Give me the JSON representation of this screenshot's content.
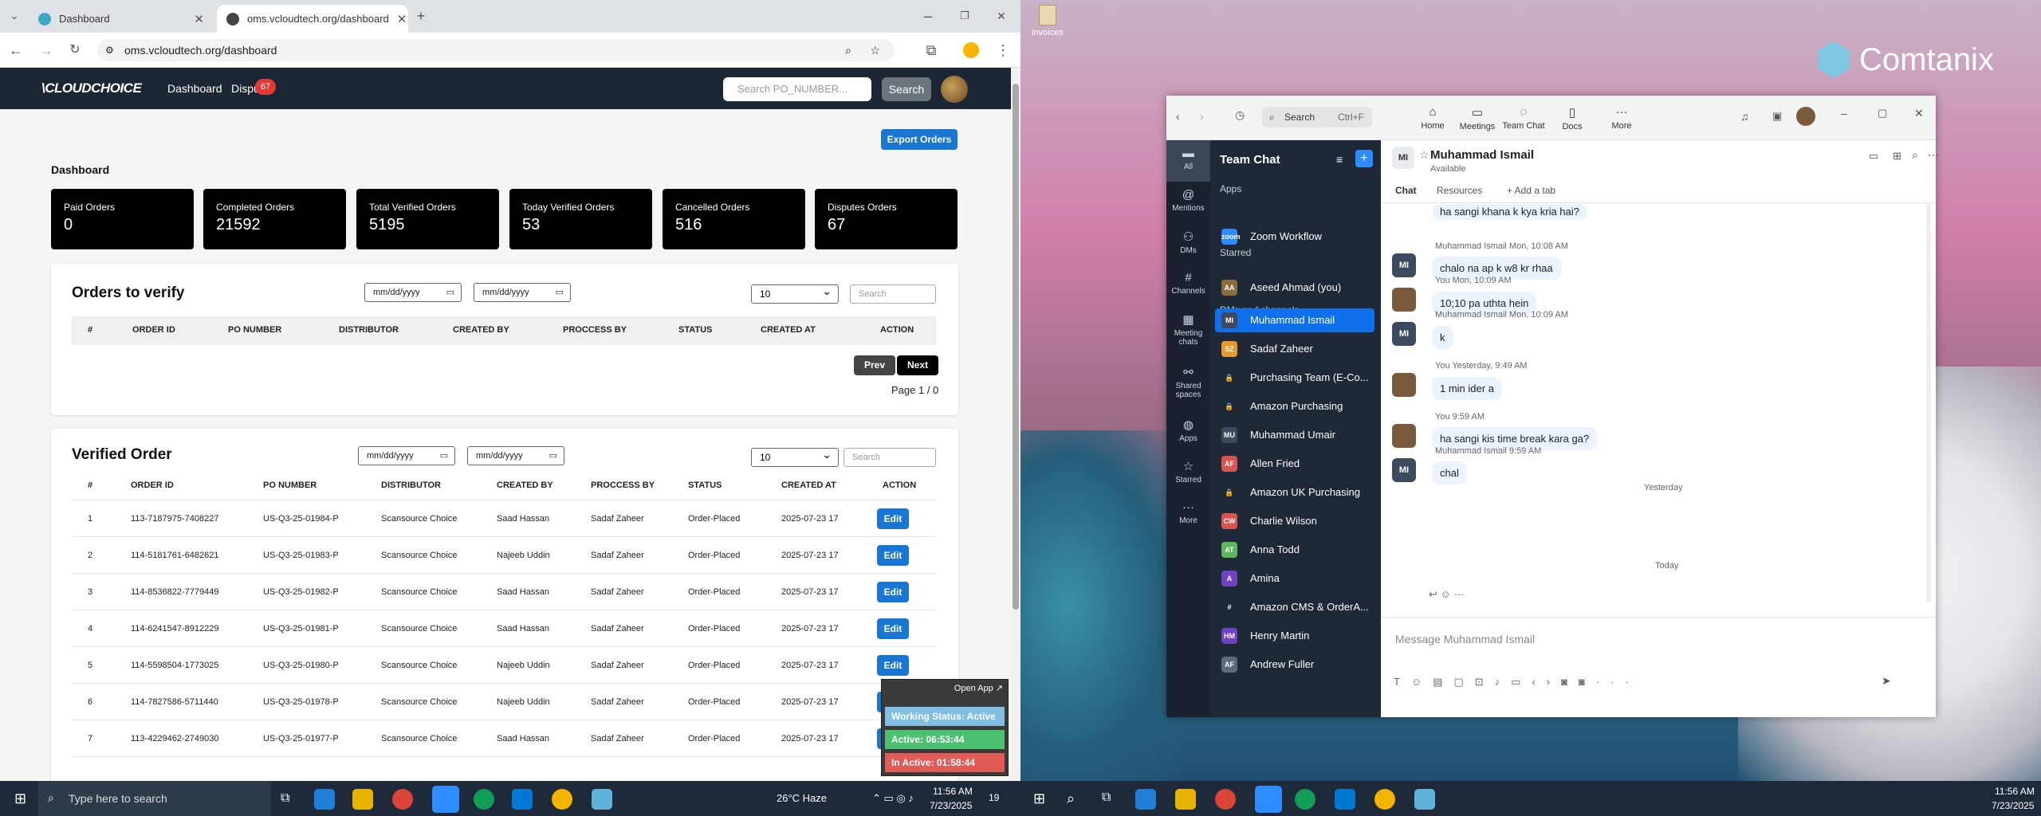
{
  "browser": {
    "tabs": [
      {
        "title": "Dashboard"
      },
      {
        "title": "oms.vcloudtech.org/dashboard"
      }
    ],
    "url": "oms.vcloudtech.org/dashboard"
  },
  "app": {
    "logo": "\\CLOUDCHOICE",
    "nav": {
      "dashboard": "Dashboard",
      "disputes": "Dispu",
      "disputes_badge": "67"
    },
    "search_placeholder": "Search PO_NUMBER...",
    "search_button": "Search",
    "export_button": "Export Orders",
    "dashboard_title": "Dashboard",
    "stats": [
      {
        "label": "Paid Orders",
        "value": "0"
      },
      {
        "label": "Completed Orders",
        "value": "21592"
      },
      {
        "label": "Total Verified Orders",
        "value": "5195"
      },
      {
        "label": "Today Verified Orders",
        "value": "53"
      },
      {
        "label": "Cancelled Orders",
        "value": "516"
      },
      {
        "label": "Disputes Orders",
        "value": "67"
      }
    ],
    "verify": {
      "title": "Orders to verify",
      "date_placeholder": "mm/dd/yyyy",
      "page_size": "10",
      "search_placeholder": "Search",
      "headers": [
        "#",
        "ORDER ID",
        "PO NUMBER",
        "DISTRIBUTOR",
        "CREATED BY",
        "PROCCESS BY",
        "STATUS",
        "CREATED AT",
        "ACTION"
      ],
      "prev": "Prev",
      "next": "Next",
      "page": "Page 1 / 0"
    },
    "verified": {
      "title": "Verified Order",
      "date_placeholder": "mm/dd/yyyy",
      "page_size": "10",
      "search_placeholder": "Search",
      "headers": [
        "#",
        "ORDER ID",
        "PO NUMBER",
        "DISTRIBUTOR",
        "CREATED BY",
        "PROCCESS BY",
        "STATUS",
        "CREATED AT",
        "ACTION"
      ],
      "edit": "Edit",
      "rows": [
        [
          "1",
          "113-7187975-7408227",
          "US-Q3-25-01984-P",
          "Scansource Choice",
          "Saad Hassan",
          "Sadaf Zaheer",
          "Order-Placed",
          "2025-07-23 17"
        ],
        [
          "2",
          "114-5181761-6482621",
          "US-Q3-25-01983-P",
          "Scansource Choice",
          "Najeeb Uddin",
          "Sadaf Zaheer",
          "Order-Placed",
          "2025-07-23 17"
        ],
        [
          "3",
          "114-8536822-7779449",
          "US-Q3-25-01982-P",
          "Scansource Choice",
          "Saad Hassan",
          "Sadaf Zaheer",
          "Order-Placed",
          "2025-07-23 17"
        ],
        [
          "4",
          "114-6241547-8912229",
          "US-Q3-25-01981-P",
          "Scansource Choice",
          "Saad Hassan",
          "Sadaf Zaheer",
          "Order-Placed",
          "2025-07-23 17"
        ],
        [
          "5",
          "114-5598504-1773025",
          "US-Q3-25-01980-P",
          "Scansource Choice",
          "Najeeb Uddin",
          "Sadaf Zaheer",
          "Order-Placed",
          "2025-07-23 17"
        ],
        [
          "6",
          "114-7827586-5711440",
          "US-Q3-25-01978-P",
          "Scansource Choice",
          "Najeeb Uddin",
          "Sadaf Zaheer",
          "Order-Placed",
          "2025-07-23 17"
        ],
        [
          "7",
          "113-4229462-2749030",
          "US-Q3-25-01977-P",
          "Scansource Choice",
          "Saad Hassan",
          "Sadaf Zaheer",
          "Order-Placed",
          "2025-07-23 17"
        ]
      ]
    }
  },
  "widget": {
    "open_app": "Open App ↗",
    "working": "Working Status: Active",
    "active": "Active: 06:53:44",
    "inactive": "In Active: 01:58:44"
  },
  "taskbar_left": {
    "search": "Type here to search",
    "weather": "26°C  Haze",
    "time": "11:56 AM",
    "date": "7/23/2025",
    "notif": "19"
  },
  "taskbar_right": {
    "time": "11:56 AM",
    "date": "7/23/2025"
  },
  "desktop": {
    "icon_label": "invoices",
    "brand": "Comtanix"
  },
  "zoom": {
    "search": "Search",
    "shortcut": "Ctrl+F",
    "top": [
      "Home",
      "Meetings",
      "Team Chat",
      "Docs",
      "More"
    ],
    "rail": [
      "All",
      "Mentions",
      "DMs",
      "Channels",
      "Meeting chats",
      "Shared spaces",
      "Apps",
      "Starred",
      "More"
    ],
    "list_title": "Team Chat",
    "sections": {
      "apps": "Apps",
      "starred": "Starred",
      "dms": "DMs and channels"
    },
    "items": [
      {
        "name": "Zoom Workflow",
        "av": "zoom",
        "color": "#2d8cff"
      },
      {
        "name": "Aseed Ahmad (you)",
        "av": "AA",
        "color": "#8a6d3b"
      },
      {
        "name": "Muhammad Ismail",
        "av": "MI",
        "color": "#3b4a5e"
      },
      {
        "name": "Sadaf Zaheer",
        "av": "SZ",
        "color": "#e59a2b"
      },
      {
        "name": "Purchasing Team (E-Co...",
        "av": "🔒",
        "color": "transparent"
      },
      {
        "name": "Amazon Purchasing",
        "av": "🔒",
        "color": "transparent"
      },
      {
        "name": "Muhammad Umair",
        "av": "MU",
        "color": "#3b4a5e"
      },
      {
        "name": "Allen Fried",
        "av": "AF",
        "color": "#d9534f"
      },
      {
        "name": "Amazon UK Purchasing",
        "av": "🔒",
        "color": "transparent"
      },
      {
        "name": "Charlie Wilson",
        "av": "CW",
        "color": "#d9534f"
      },
      {
        "name": "Anna Todd",
        "av": "AT",
        "color": "#5cb85c"
      },
      {
        "name": "Amina",
        "av": "A",
        "color": "#6f42c1"
      },
      {
        "name": "Amazon CMS & OrderA...",
        "av": "#",
        "color": "transparent"
      },
      {
        "name": "Henry Martin",
        "av": "HM",
        "color": "#6f42c1"
      },
      {
        "name": "Andrew Fuller",
        "av": "AF",
        "color": "#5a6b7d"
      }
    ],
    "chat_name": "Muhammad Ismail",
    "chat_status": "Available",
    "tabs": [
      "Chat",
      "Resources",
      "+ Add a tab"
    ],
    "messages": [
      {
        "meta": "",
        "text": "ha sangi khana k kya kria hai?",
        "who": "you"
      },
      {
        "meta": "Muhammad Ismail Mon, 10:08 AM",
        "text": "chalo na ap k w8 kr rhaa",
        "who": "mi"
      },
      {
        "meta": "You Mon, 10:09 AM",
        "text": "10;10 pa uthta hein",
        "who": "you"
      },
      {
        "meta": "Muhammad Ismail Mon, 10:09 AM",
        "text": "k",
        "who": "mi"
      },
      {
        "meta": "You Yesterday, 9:49 AM",
        "text": "1 min ider a",
        "who": "you"
      },
      {
        "meta": "You 9:59 AM",
        "text": "ha sangi kis time break kara ga?",
        "who": "you"
      },
      {
        "meta": "Muhammad Ismail 9:59 AM",
        "text": "chal",
        "who": "mi"
      }
    ],
    "day_yesterday": "Yesterday",
    "day_today": "Today",
    "compose_placeholder": "Message Muhammad Ismail"
  }
}
